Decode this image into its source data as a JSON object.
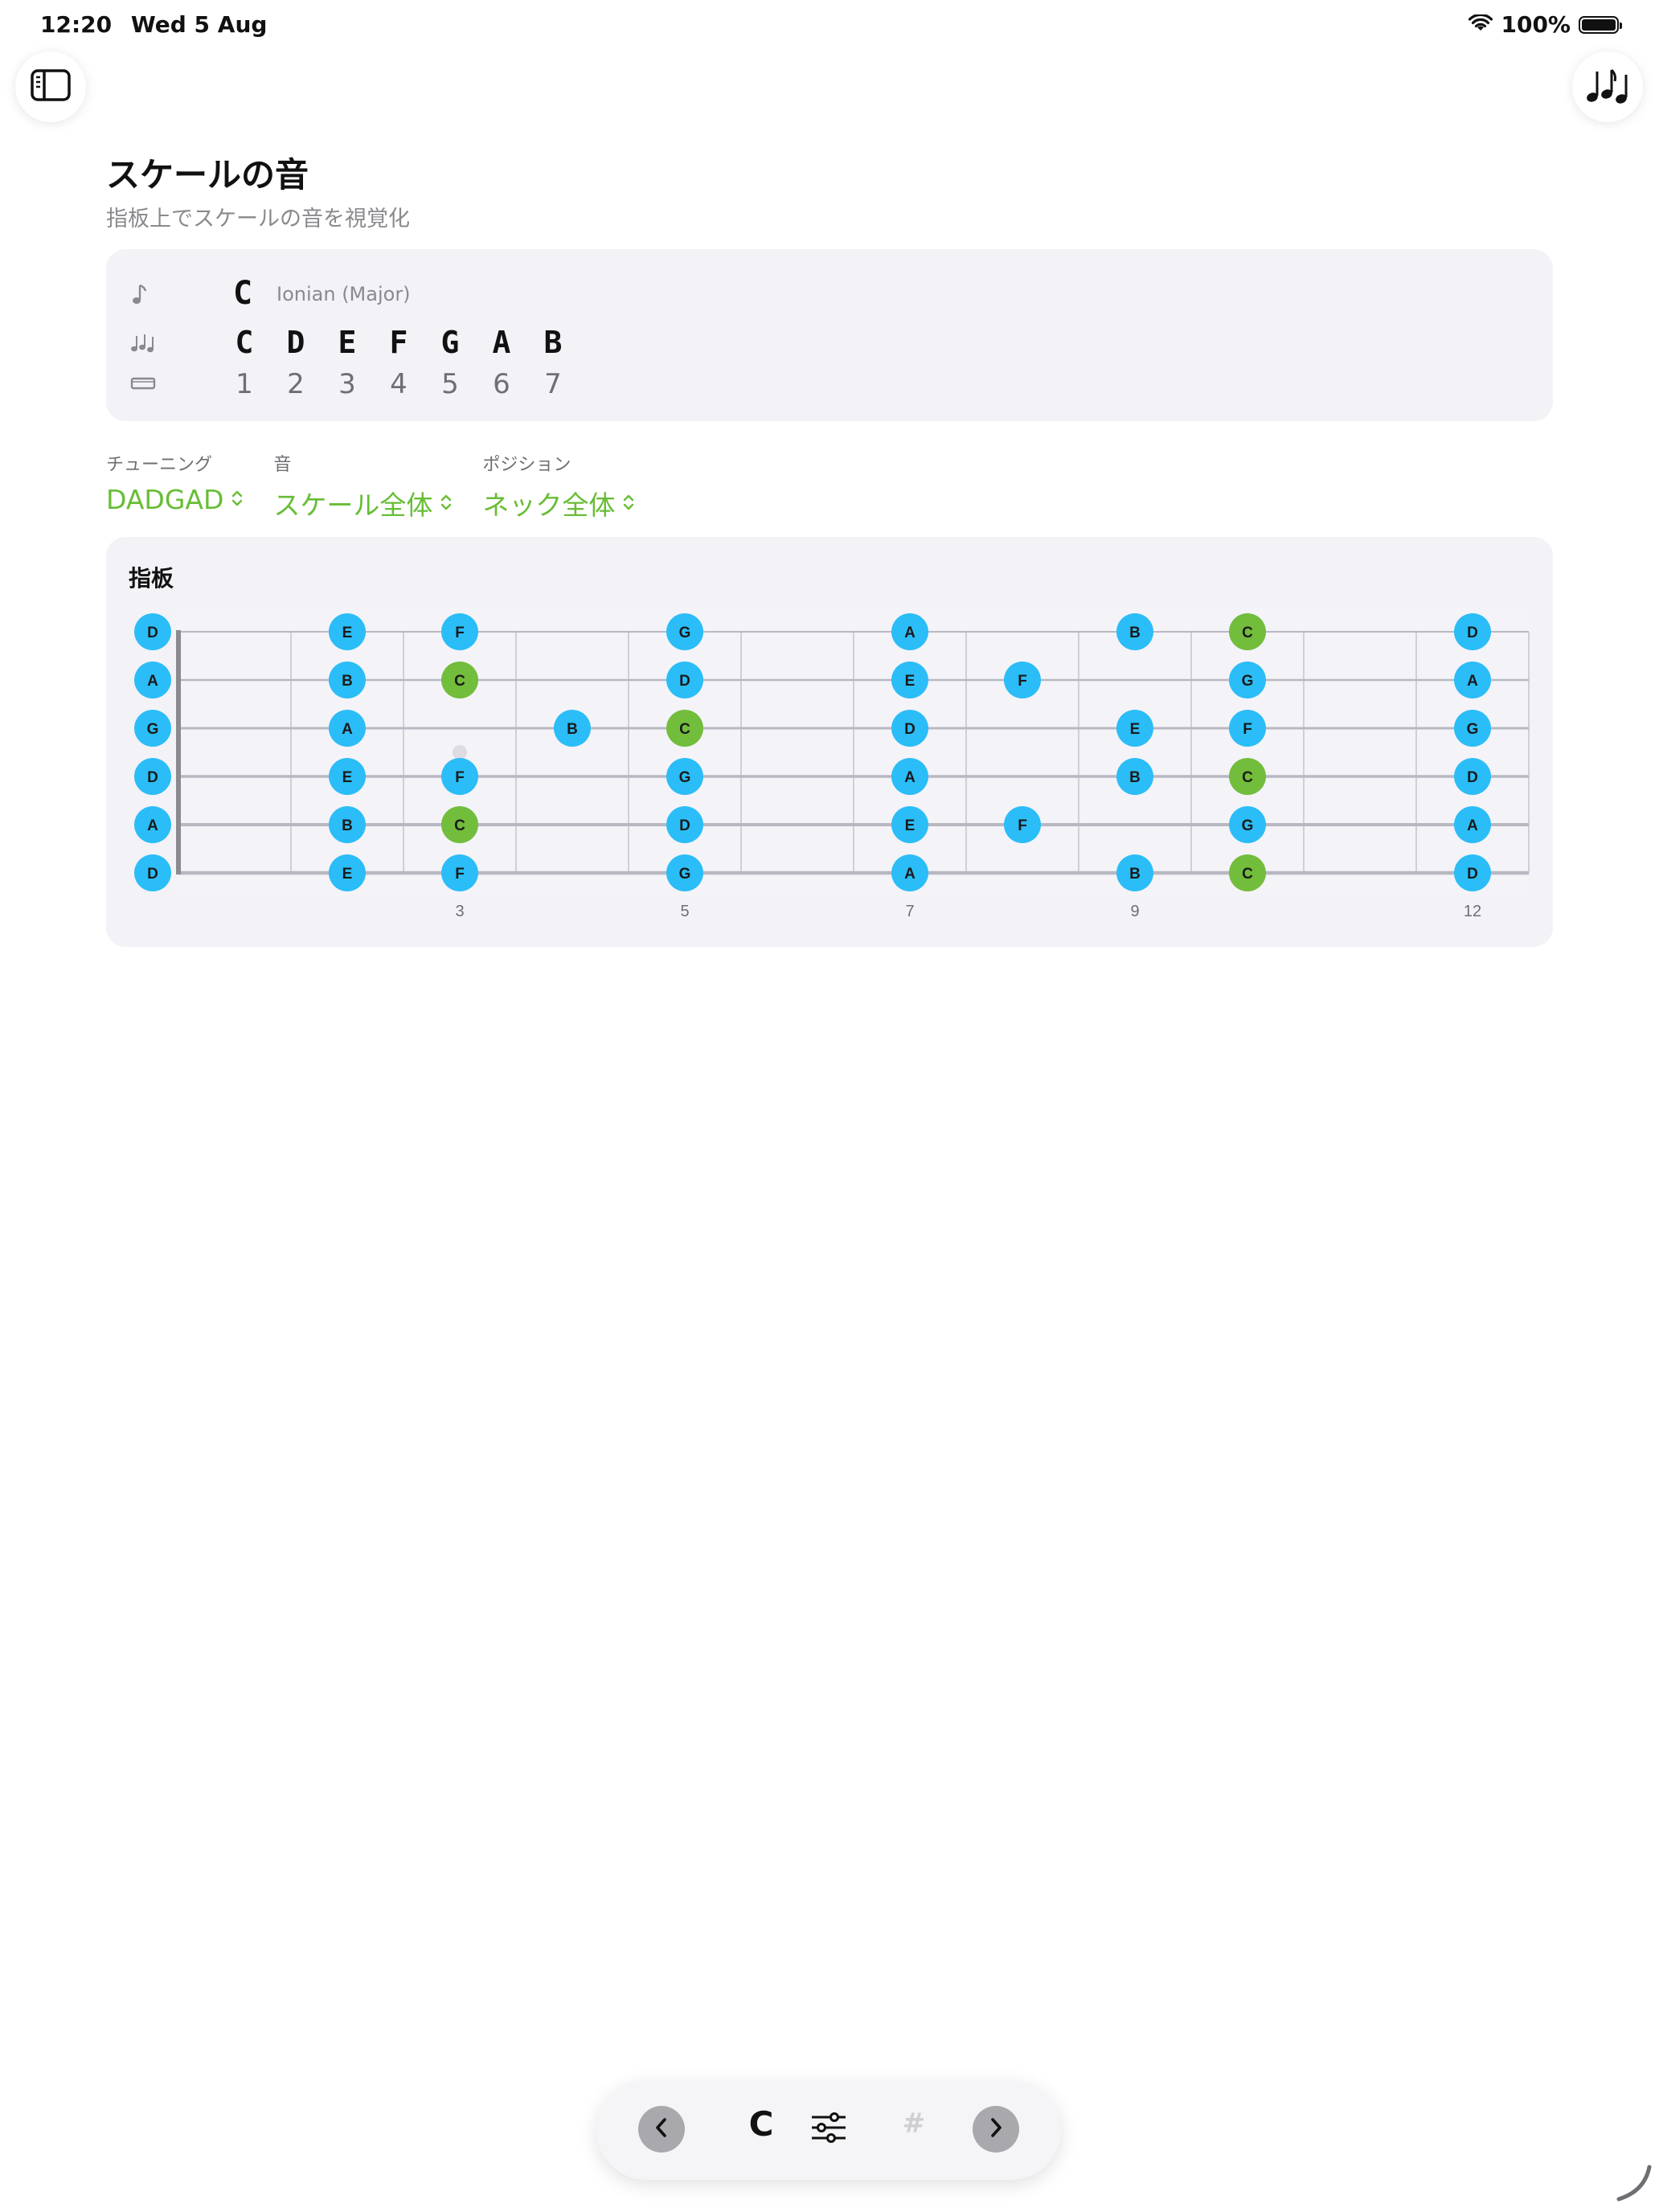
{
  "status": {
    "time": "12:20",
    "date": "Wed 5 Aug",
    "battery": "100%"
  },
  "page": {
    "title": "スケールの音",
    "subtitle": "指板上でスケールの音を視覚化"
  },
  "scale": {
    "root": "C",
    "mode": "Ionian (Major)",
    "notes": [
      "C",
      "D",
      "E",
      "F",
      "G",
      "A",
      "B"
    ],
    "degrees": [
      "1",
      "2",
      "3",
      "4",
      "5",
      "6",
      "7"
    ]
  },
  "selectors": [
    {
      "label": "チューニング",
      "value": "DADGAD"
    },
    {
      "label": "音",
      "value": "スケール全体"
    },
    {
      "label": "ポジション",
      "value": "ネック全体"
    }
  ],
  "fretboard": {
    "title": "指板",
    "fret_count": 12,
    "strings_top_to_bottom": [
      "D",
      "A",
      "G",
      "D",
      "A",
      "D"
    ],
    "fret_markers": [
      "3",
      "5",
      "7",
      "9",
      "12"
    ],
    "colors": {
      "root": "#72bd3c",
      "note": "#2bbdf7",
      "card": "#f2f2f7",
      "accent": "#68bd36"
    },
    "rows": [
      [
        {
          "fret": 0,
          "note": "D"
        },
        {
          "fret": 2,
          "note": "E"
        },
        {
          "fret": 3,
          "note": "F"
        },
        {
          "fret": 5,
          "note": "G"
        },
        {
          "fret": 7,
          "note": "A"
        },
        {
          "fret": 9,
          "note": "B"
        },
        {
          "fret": 10,
          "note": "C"
        },
        {
          "fret": 12,
          "note": "D"
        }
      ],
      [
        {
          "fret": 0,
          "note": "A"
        },
        {
          "fret": 2,
          "note": "B"
        },
        {
          "fret": 3,
          "note": "C"
        },
        {
          "fret": 5,
          "note": "D"
        },
        {
          "fret": 7,
          "note": "E"
        },
        {
          "fret": 8,
          "note": "F"
        },
        {
          "fret": 10,
          "note": "G"
        },
        {
          "fret": 12,
          "note": "A"
        }
      ],
      [
        {
          "fret": 0,
          "note": "G"
        },
        {
          "fret": 2,
          "note": "A"
        },
        {
          "fret": 4,
          "note": "B"
        },
        {
          "fret": 5,
          "note": "C"
        },
        {
          "fret": 7,
          "note": "D"
        },
        {
          "fret": 9,
          "note": "E"
        },
        {
          "fret": 10,
          "note": "F"
        },
        {
          "fret": 12,
          "note": "G"
        }
      ],
      [
        {
          "fret": 0,
          "note": "D"
        },
        {
          "fret": 2,
          "note": "E"
        },
        {
          "fret": 3,
          "note": "F"
        },
        {
          "fret": 5,
          "note": "G"
        },
        {
          "fret": 7,
          "note": "A"
        },
        {
          "fret": 9,
          "note": "B"
        },
        {
          "fret": 10,
          "note": "C"
        },
        {
          "fret": 12,
          "note": "D"
        }
      ],
      [
        {
          "fret": 0,
          "note": "A"
        },
        {
          "fret": 2,
          "note": "B"
        },
        {
          "fret": 3,
          "note": "C"
        },
        {
          "fret": 5,
          "note": "D"
        },
        {
          "fret": 7,
          "note": "E"
        },
        {
          "fret": 8,
          "note": "F"
        },
        {
          "fret": 10,
          "note": "G"
        },
        {
          "fret": 12,
          "note": "A"
        }
      ],
      [
        {
          "fret": 0,
          "note": "D"
        },
        {
          "fret": 2,
          "note": "E"
        },
        {
          "fret": 3,
          "note": "F"
        },
        {
          "fret": 5,
          "note": "G"
        },
        {
          "fret": 7,
          "note": "A"
        },
        {
          "fret": 9,
          "note": "B"
        },
        {
          "fret": 10,
          "note": "C"
        },
        {
          "fret": 12,
          "note": "D"
        }
      ]
    ]
  },
  "toolbar": {
    "key": "C",
    "sharp": "#"
  },
  "icons": {
    "sidebar": "sidebar-toggle-icon",
    "music": "music-notes-icon",
    "note": "music-note-icon",
    "notes": "music-notes-icon",
    "ruler": "ruler-icon",
    "previous": "chevron-left-icon",
    "next": "chevron-right-icon",
    "settings": "sliders-icon",
    "sharp": "sharp-icon"
  }
}
